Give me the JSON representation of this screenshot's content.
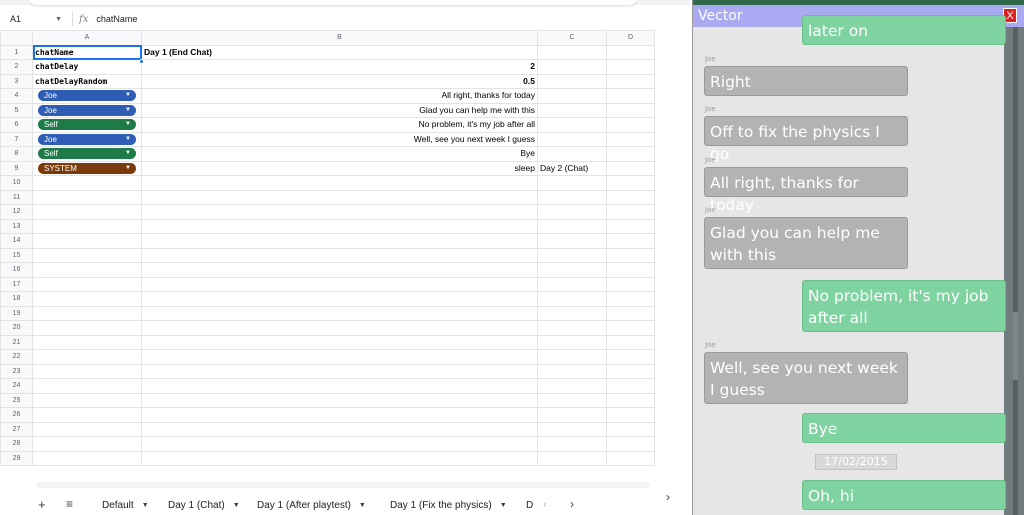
{
  "formula_bar": {
    "cell_ref": "A1",
    "fx": "fx",
    "value": "chatName"
  },
  "grid": {
    "col_headers": [
      "A",
      "B",
      "C",
      "D"
    ],
    "rows": [
      {
        "num": "1",
        "a": "chatName",
        "b": "Day 1 (End Chat)",
        "c": ""
      },
      {
        "num": "2",
        "a": "chatDelay",
        "b": "2",
        "c": ""
      },
      {
        "num": "3",
        "a": "chatDelayRandom",
        "b": "0.5",
        "c": ""
      },
      {
        "num": "4",
        "chip": "Joe",
        "b": "All right, thanks for today",
        "c": ""
      },
      {
        "num": "5",
        "chip": "Joe",
        "b": "Glad you can help me with this",
        "c": ""
      },
      {
        "num": "6",
        "chip": "Self",
        "b": "No problem, it's my job after all",
        "c": ""
      },
      {
        "num": "7",
        "chip": "Joe",
        "b": "Well, see you next week I guess",
        "c": ""
      },
      {
        "num": "8",
        "chip": "Self",
        "b": "Bye",
        "c": ""
      },
      {
        "num": "9",
        "chip": "SYSTEM",
        "b": "sleep",
        "c": "Day 2 (Chat)"
      }
    ],
    "empty_rows": [
      "10",
      "11",
      "12",
      "13",
      "14",
      "15",
      "16",
      "17",
      "18",
      "19",
      "20",
      "21",
      "22",
      "23",
      "24",
      "25",
      "26",
      "27",
      "28",
      "29"
    ]
  },
  "chip_colors": {
    "Joe": "#2f5cb5",
    "Self": "#1e7a47",
    "SYSTEM": "#7a3b0c"
  },
  "sheet_tabs": {
    "add_icon": "+",
    "all_sheets_icon": "≡",
    "tabs": [
      "Default",
      "Day 1 (Chat)",
      "Day 1 (After playtest)",
      "Day 1 (Fix the physics)",
      "D"
    ],
    "nav_left": "‹",
    "nav_right": "›",
    "side_expand": "›"
  },
  "chat": {
    "title": "Vector",
    "close": "X",
    "messages": [
      {
        "sender": "",
        "text": "later on",
        "dir": "out"
      },
      {
        "sender": "Joe",
        "text": "Right",
        "dir": "in"
      },
      {
        "sender": "Joe",
        "text": "Off to fix the physics I go",
        "dir": "in"
      },
      {
        "sender": "Joe",
        "text": "All right, thanks for today",
        "dir": "in"
      },
      {
        "sender": "Joe",
        "text": "Glad you can help me with this",
        "dir": "in"
      },
      {
        "sender": "",
        "text": "No problem, it's my job after all",
        "dir": "out"
      },
      {
        "sender": "Joe",
        "text": "Well, see you next week I guess",
        "dir": "in"
      },
      {
        "sender": "",
        "text": "Bye",
        "dir": "out"
      },
      {
        "sender": "",
        "text": "Oh, hi",
        "dir": "out"
      }
    ],
    "date": "17/02/2015"
  }
}
